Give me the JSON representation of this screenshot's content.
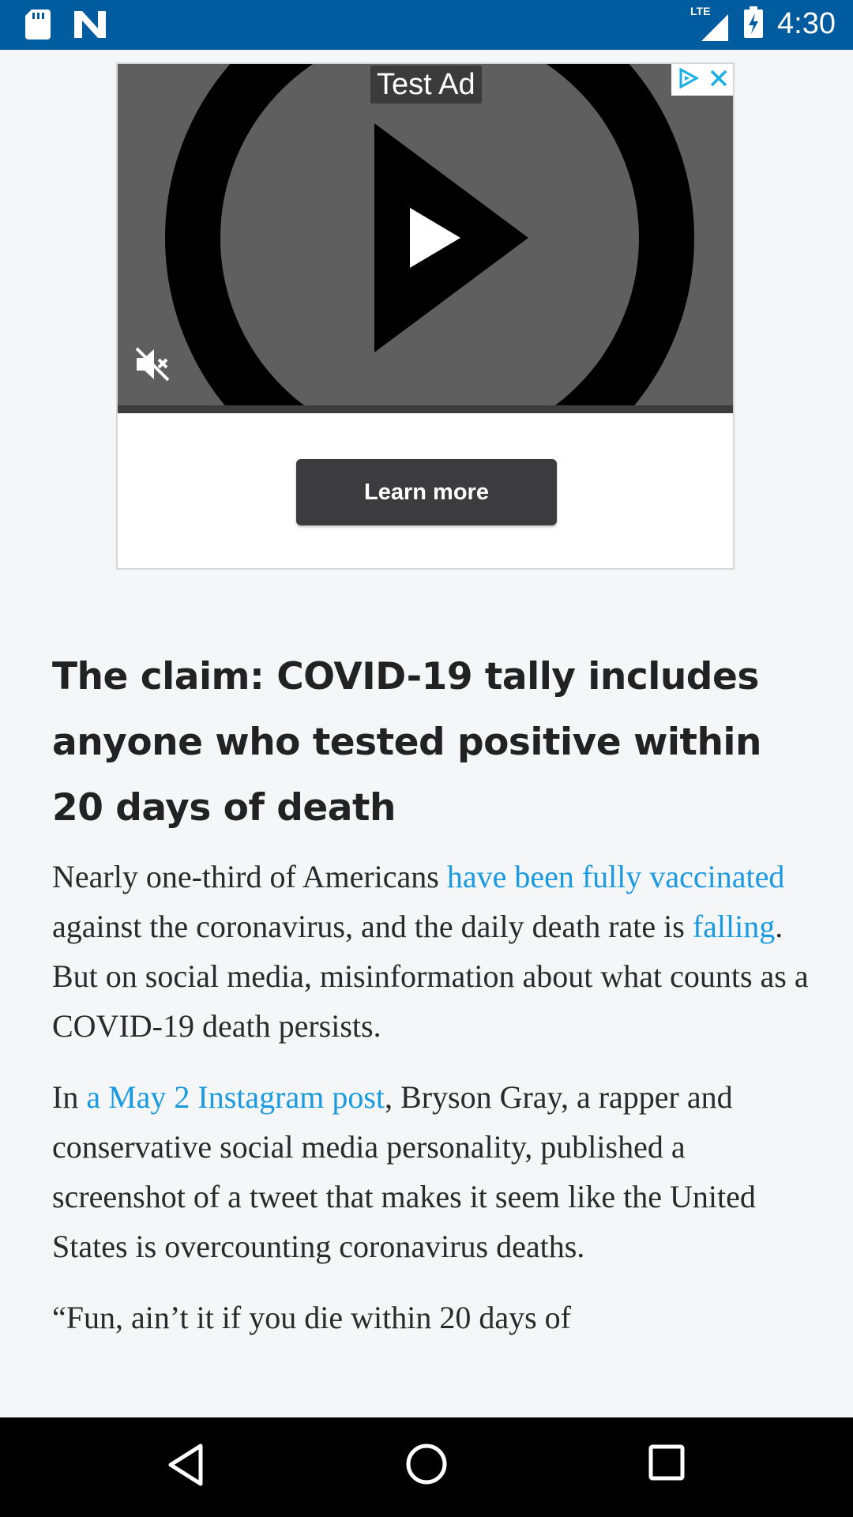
{
  "status_bar": {
    "time": "4:30",
    "network": "LTE",
    "icons": [
      "sd-card-icon",
      "n-app-icon",
      "signal-icon",
      "battery-charging-icon"
    ]
  },
  "ad": {
    "label": "Test Ad",
    "cta": "Learn more"
  },
  "article": {
    "headline": "The claim: COVID-19 tally includes anyone who tested positive within 20 days of death",
    "p1": {
      "t1": "Nearly one-third of Americans ",
      "link1": "have been fully vaccinated",
      "t2": " against the coronavirus, and the daily death rate is ",
      "link2": "falling",
      "t3": ". But on social media, misinformation about what counts as a COVID-19 death persists."
    },
    "p2": {
      "t1": "In ",
      "link1": "a May 2 Instagram post",
      "t2": ", Bryson Gray, a rapper and conservative social media personality, published a screenshot of a tweet that makes it seem like the United States is overcounting coronavirus deaths."
    },
    "p3_partial": "“Fun, ain’t it if you die within 20 days of"
  },
  "nav": {
    "icons": [
      "back-icon",
      "home-icon",
      "recents-icon"
    ]
  },
  "colors": {
    "status_bar": "#015b9f",
    "link": "#1a9ae0",
    "background": "#f5f6f8"
  }
}
